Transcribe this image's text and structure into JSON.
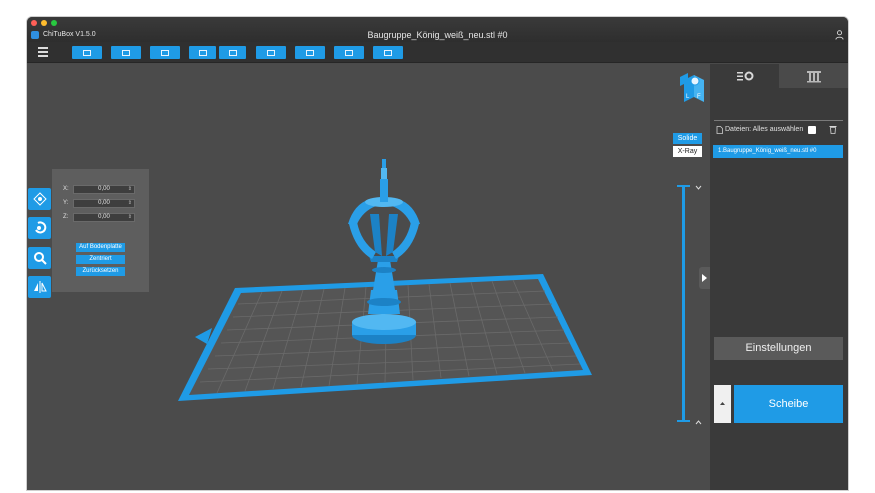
{
  "window": {
    "app_name": "ChiTuBox V1.5.0",
    "title": "Baugruppe_König_weiß_neu.stl #0",
    "traffic_colors": [
      "#ff5f57",
      "#febc2e",
      "#28c840"
    ]
  },
  "colors": {
    "accent": "#1f9be6",
    "viewport_bg": "#4b4b4b",
    "panel_bg": "#3a3a3a",
    "model": "#2a9fe8",
    "plate": "#4a4a4a"
  },
  "toolbar": {
    "icons": [
      "open-file-icon",
      "window-icon",
      "select-all-icon",
      "import-icon",
      "export-icon",
      "view-icon",
      "arrange-icon",
      "support-icon",
      "hollow-icon"
    ]
  },
  "move_panel": {
    "x_label": "X:",
    "y_label": "Y:",
    "z_label": "Z:",
    "x_value": "0,00",
    "y_value": "0,00",
    "z_value": "0,00",
    "btn_bed": "Auf Bodenplatte",
    "btn_center": "Zentriert",
    "btn_reset": "Zurücksetzen"
  },
  "view_modes": {
    "solid": "Solide",
    "xray": "X-Ray"
  },
  "right_panel": {
    "files_label": "Dateien: Alles auswählen",
    "file_item": "1.Baugruppe_König_weiß_neu.stl #0",
    "settings_label": "Einstellungen",
    "slice_label": "Scheibe"
  }
}
